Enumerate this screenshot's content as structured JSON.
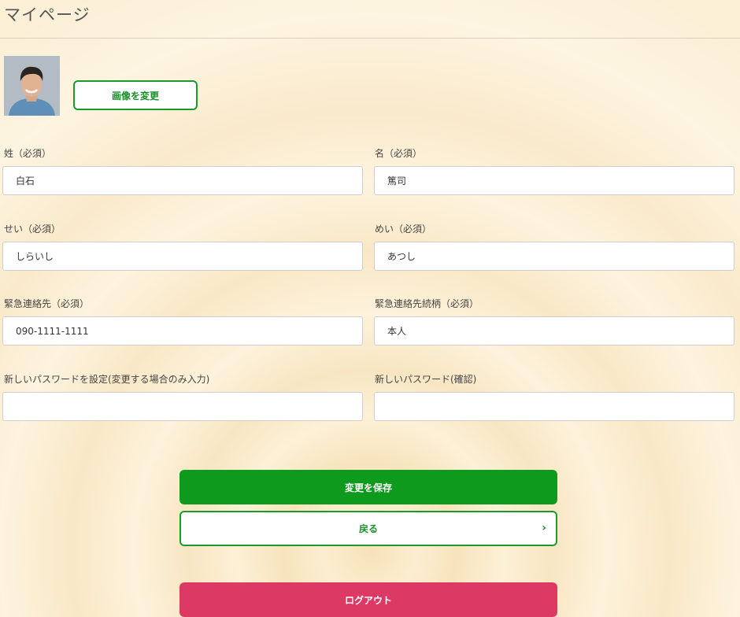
{
  "header": {
    "title": "マイページ"
  },
  "profile": {
    "change_image_label": "画像を変更"
  },
  "form": {
    "last_name": {
      "label": "姓（必須）",
      "value": "白石"
    },
    "first_name": {
      "label": "名（必須）",
      "value": "篤司"
    },
    "last_name_kana": {
      "label": "せい（必須）",
      "value": "しらいし"
    },
    "first_name_kana": {
      "label": "めい（必須）",
      "value": "あつし"
    },
    "emergency_contact": {
      "label": "緊急連絡先（必須）",
      "value": "090-1111-1111"
    },
    "emergency_relation": {
      "label": "緊急連絡先続柄（必須）",
      "value": "本人"
    },
    "new_password": {
      "label": "新しいパスワードを設定(変更する場合のみ入力)",
      "value": ""
    },
    "new_password_confirm": {
      "label": "新しいパスワード(確認)",
      "value": ""
    }
  },
  "actions": {
    "save_label": "変更を保存",
    "back_label": "戻る",
    "back_chevron": "›",
    "logout_label": "ログアウト"
  },
  "colors": {
    "primary_green": "#0e9a1c",
    "outline_green": "#1a9a2a",
    "logout_red": "#dc3a64"
  }
}
